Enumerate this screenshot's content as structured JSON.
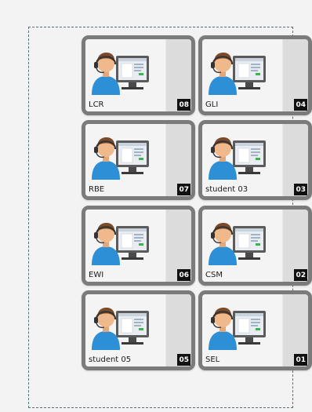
{
  "students": [
    {
      "name": "LCR",
      "number": "08"
    },
    {
      "name": "GLI",
      "number": "04"
    },
    {
      "name": "RBE",
      "number": "07"
    },
    {
      "name": "student 03",
      "number": "03"
    },
    {
      "name": "EWI",
      "number": "06"
    },
    {
      "name": "CSM",
      "number": "02"
    },
    {
      "name": "student 05",
      "number": "05"
    },
    {
      "name": "SEL",
      "number": "01"
    }
  ],
  "colors": {
    "tile_border": "#7b7b7b",
    "badge_bg": "#111111",
    "person_shirt": "#2d8fd5",
    "person_skin": "#f0b98c",
    "person_hair": "#7a4a2a"
  },
  "icons": {
    "tile_avatar": "student-at-computer-icon"
  }
}
